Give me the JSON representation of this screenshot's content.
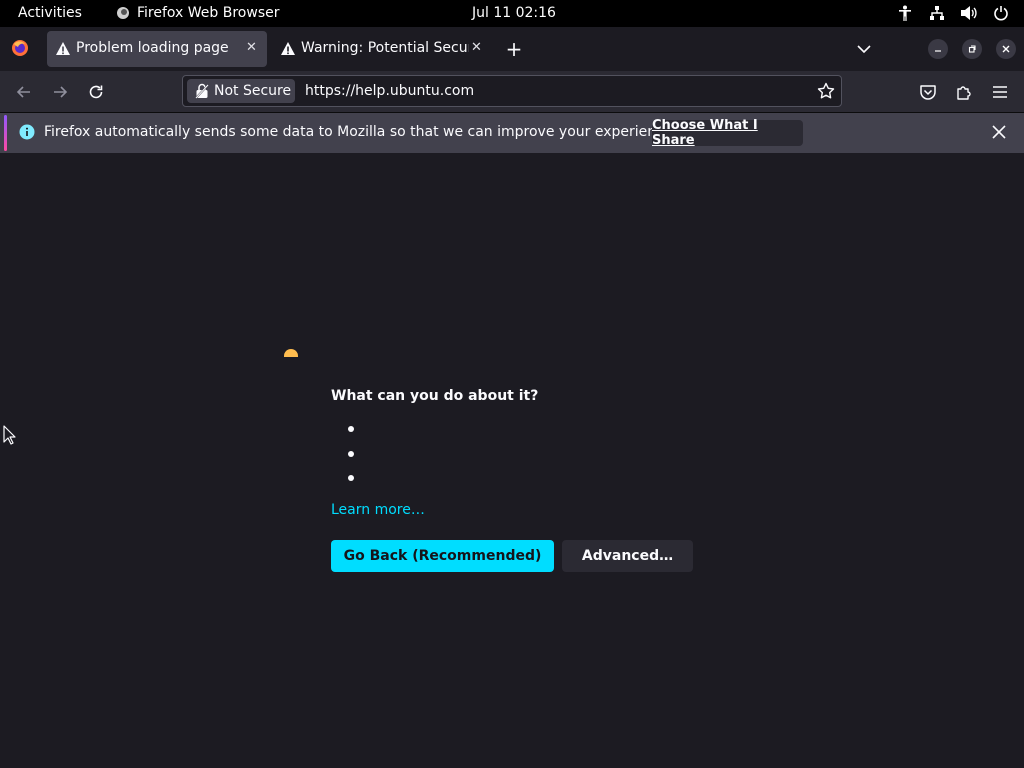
{
  "topbar": {
    "activities": "Activities",
    "app_name": "Firefox Web Browser",
    "clock": "Jul 11  02:16",
    "tray_icons": [
      "accessibility-icon",
      "network-icon",
      "volume-icon",
      "power-icon"
    ]
  },
  "tabs": [
    {
      "label": "Problem loading page",
      "icon": "warning-icon",
      "active": true
    },
    {
      "label": "Warning: Potential Securi",
      "icon": "warning-icon",
      "active": false
    }
  ],
  "navbar": {
    "security_label": "Not Secure",
    "url": "https://help.ubuntu.com"
  },
  "notification": {
    "message": "Firefox automatically sends some data to Mozilla so that we can improve your experience.",
    "button_label": "Choose What I Share"
  },
  "page": {
    "what_title": "What can you do about it?",
    "bullet_count": 3,
    "learn_more": "Learn more…",
    "go_back_label": "Go Back (Recommended)",
    "advanced_label": "Advanced…"
  },
  "colors": {
    "accent": "#00ddff",
    "warning": "#ffbd4f",
    "background": "#1c1b22"
  }
}
